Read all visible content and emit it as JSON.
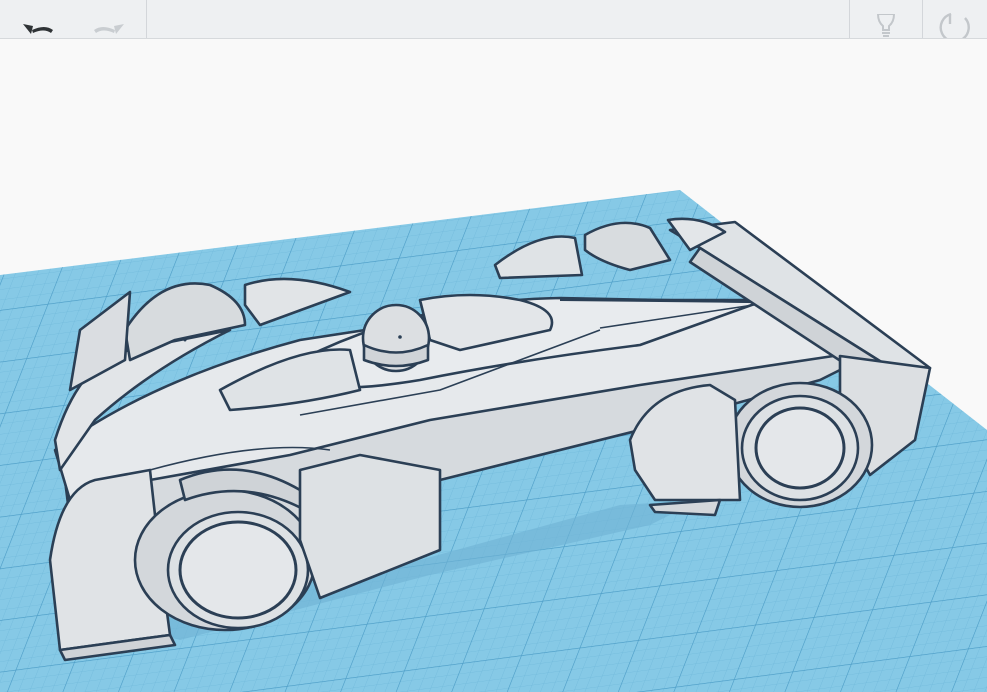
{
  "toolbar": {
    "undo": {
      "icon": "undo-icon",
      "enabled": true
    },
    "redo": {
      "icon": "redo-icon",
      "enabled": false
    },
    "hint": {
      "icon": "lightbulb-icon",
      "enabled": false
    },
    "reset_view": {
      "icon": "reset-view-icon",
      "enabled": false
    }
  },
  "workplane": {
    "color": "#7fc6e3",
    "grid": true
  },
  "model": {
    "name": "race-car",
    "color": "#e3e7ea",
    "outline_color": "#2b3f55"
  }
}
